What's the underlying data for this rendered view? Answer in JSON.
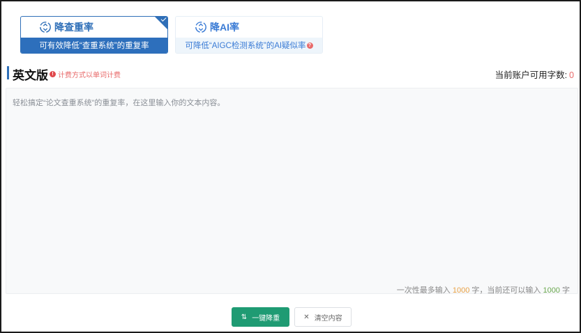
{
  "tabs": [
    {
      "title": "降查重率",
      "subtitle": "可有效降低“查重系统”的重复率",
      "icon": "recycle-icon",
      "active": true
    },
    {
      "title": "降AI率",
      "subtitle": "可降低“AIGC检测系统”的AI疑似率",
      "icon": "recycle-icon",
      "active": false
    }
  ],
  "section": {
    "title": "英文版",
    "billing_note": "计费方式以单词计费",
    "quota_label": "当前账户可用字数:",
    "quota_value": "0"
  },
  "editor": {
    "placeholder": "轻松搞定“论文查重系统”的重复率，在这里输入你的文本内容。",
    "limit_prefix": "一次性最多输入",
    "limit_max": "1000",
    "limit_mid": "字，当前还可以输入",
    "limit_remaining": "1000",
    "limit_suffix": "字"
  },
  "actions": {
    "primary_label": "一键降重",
    "primary_icon": "sort-icon",
    "secondary_label": "清空内容",
    "secondary_icon": "close-icon"
  },
  "colors": {
    "brand_blue": "#2f6fb8",
    "primary_green": "#1f9b73",
    "alert_red": "#e86a6a"
  }
}
